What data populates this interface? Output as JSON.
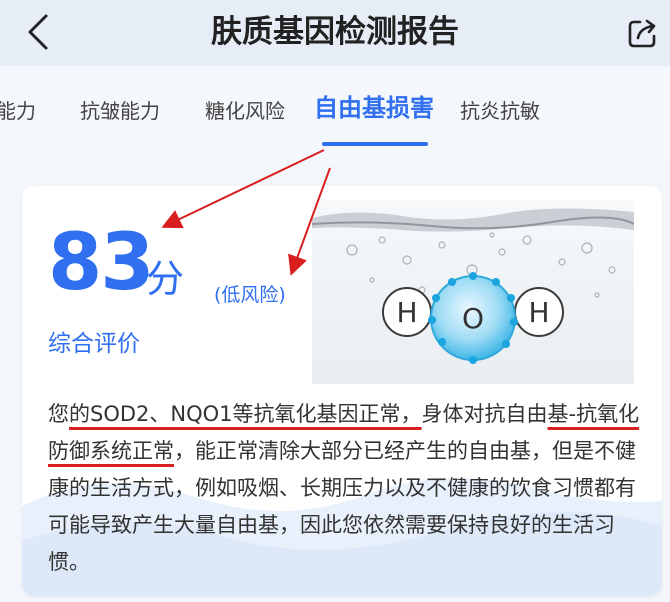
{
  "header": {
    "title": "肤质基因检测报告",
    "back_icon": "chevron-left-icon",
    "share_icon": "share-icon"
  },
  "tabs": [
    {
      "label": "能力"
    },
    {
      "label": "抗皱能力"
    },
    {
      "label": "糖化风险"
    },
    {
      "label": "自由基损害",
      "active": true
    },
    {
      "label": "抗炎抗敏"
    }
  ],
  "result": {
    "score": "83",
    "unit": "分",
    "risk": "(低风险)",
    "overall_label": "综合评价"
  },
  "molecule": {
    "atom_left": "H",
    "atom_center": "O",
    "atom_right": "H"
  },
  "description": {
    "p1": "您",
    "p2": "的SOD2、NQO1等抗氧化基因正常，",
    "p3": "身体对抗自由",
    "p4": "基-抗氧化防御系统正常",
    "p5": "，能正常清除大部分已经产生的自由基，但是不健康的生活方式，例如吸烟、长期压力以及不健康的饮食习惯都有可能导致产生大量自由基，因此您依然需要保持良好的生活习惯。"
  },
  "colors": {
    "accent": "#2f6ff0",
    "annotation": "#d81e1e",
    "header_bg": "#e6edf7"
  }
}
